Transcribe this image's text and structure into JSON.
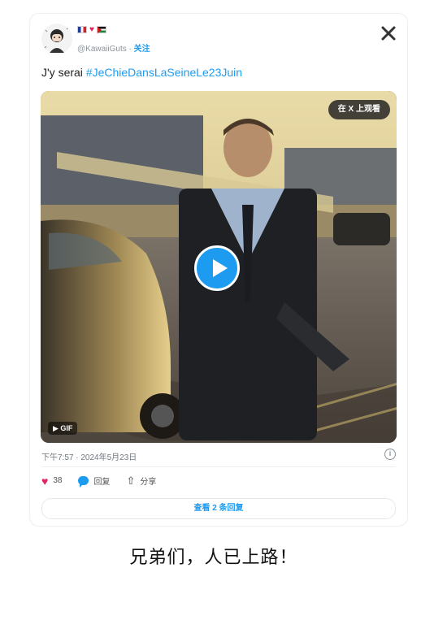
{
  "post": {
    "handle": "@KawaiiGuts",
    "separator": " · ",
    "follow_label": "关注",
    "text_prefix": "J'y serai ",
    "hashtag": "#JeChieDansLaSeineLe23Juin",
    "watch_on_x_label": "在 X 上观看",
    "gif_label": "GIF",
    "timestamp": "下午7:57 · 2024年5月23日",
    "likes_count": "38",
    "reply_label": "回复",
    "share_label": "分享",
    "view_replies_label": "查看 2 条回复"
  },
  "icons": {
    "close": "close-icon",
    "play": "play-icon",
    "info": "info-icon",
    "heart": "heart-icon",
    "reply": "reply-icon",
    "share": "share-icon"
  },
  "colors": {
    "accent": "#1d9bf0",
    "heart": "#e0245e"
  },
  "caption": "兄弟们，人已上路！"
}
